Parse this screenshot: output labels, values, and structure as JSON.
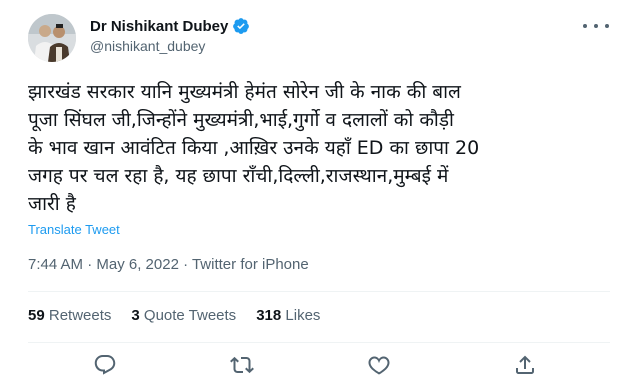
{
  "author": {
    "display_name": "Dr Nishikant Dubey",
    "handle": "@nishikant_dubey",
    "verified": true,
    "avatar_icon": "profile-photo",
    "verified_color": "#1d9bf0"
  },
  "tweet": {
    "lines": [
      "झारखंड सरकार यानि मुख्यमंत्री हेमंत सोरेन जी के नाक की बाल",
      "पूजा सिंघल जी,जिन्होंने मुख्यमंत्री,भाई,गुर्गो व दलालों को कौड़ी",
      "के भाव खान आवंटित किया ,आख़िर उनके यहाँ ED का छापा 20",
      "जगह पर चल रहा है, यह छापा राँची,दिल्ली,राजस्थान,मुम्बई में",
      "जारी है"
    ],
    "translate_label": "Translate Tweet",
    "timestamp": "7:44 AM · May 6, 2022 · Twitter for iPhone"
  },
  "stats": {
    "retweets": {
      "count": "59",
      "label": "Retweets"
    },
    "quotes": {
      "count": "3",
      "label": "Quote Tweets"
    },
    "likes": {
      "count": "318",
      "label": "Likes"
    }
  },
  "actions": [
    "reply-icon",
    "retweet-icon",
    "like-icon",
    "share-icon"
  ],
  "colors": {
    "link": "#1d9bf0",
    "secondary": "#536471",
    "text": "#0f1419"
  }
}
